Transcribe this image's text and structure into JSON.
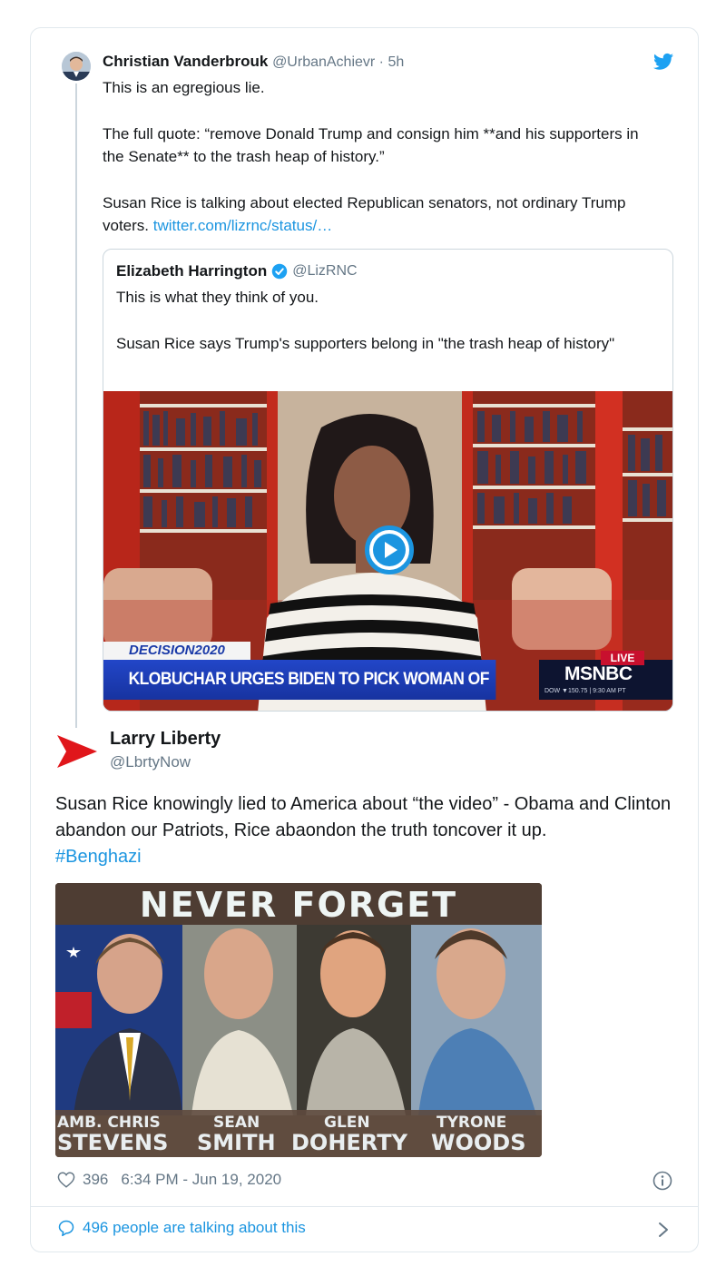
{
  "parent_tweet": {
    "author_name": "Christian Vanderbrouk",
    "handle_time": "@UrbanAchievr · 5h",
    "body": [
      "This is an egregious lie.",
      "The full quote: “remove Donald Trump and consign him **and his supporters in the Senate** to the trash heap of history.”",
      "Susan Rice is talking about elected Republican senators, not ordinary Trump voters."
    ],
    "link_text": "twitter.com/lizrnc/status/…"
  },
  "quoted_tweet": {
    "author_name": "Elizabeth Harrington",
    "handle": "@LizRNC",
    "body": [
      "This is what they think of you.",
      "Susan Rice says Trump's supporters belong in \"the trash heap of history\""
    ],
    "video": {
      "tag": "DECISION2020",
      "headline": "KLOBUCHAR URGES BIDEN TO PICK WOMAN OF COLOR FOR VP",
      "live_label": "LIVE",
      "network": "MSNBC",
      "ticker": "DOW ▼150.75 | 9:30 AM PT"
    }
  },
  "main_tweet": {
    "author_name": "Larry Liberty",
    "handle": "@LbrtyNow",
    "body": "Susan Rice knowingly lied to America about “the video” - Obama and Clinton abandon our Patriots, Rice abaondon the truth toncover it up.",
    "hashtag": "#Benghazi",
    "image": {
      "banner": "NEVER FORGET",
      "people": [
        {
          "first": "AMB. CHRIS",
          "last": "STEVENS"
        },
        {
          "first": "SEAN",
          "last": "SMITH"
        },
        {
          "first": "GLEN",
          "last": "DOHERTY"
        },
        {
          "first": "TYRONE",
          "last": "WOODS"
        }
      ]
    },
    "likes": "396",
    "timestamp": "6:34 PM - Jun 19, 2020",
    "conversation": "496 people are talking about this"
  },
  "colors": {
    "link": "#1b95e0",
    "muted": "#657786",
    "border": "#e1e8ed",
    "logo_red": "#e0161b"
  },
  "icons": [
    "twitter-bird-icon",
    "verified-badge-icon",
    "play-icon",
    "heart-icon",
    "info-icon",
    "comment-icon",
    "chevron-right-icon",
    "brand-logo-icon"
  ]
}
